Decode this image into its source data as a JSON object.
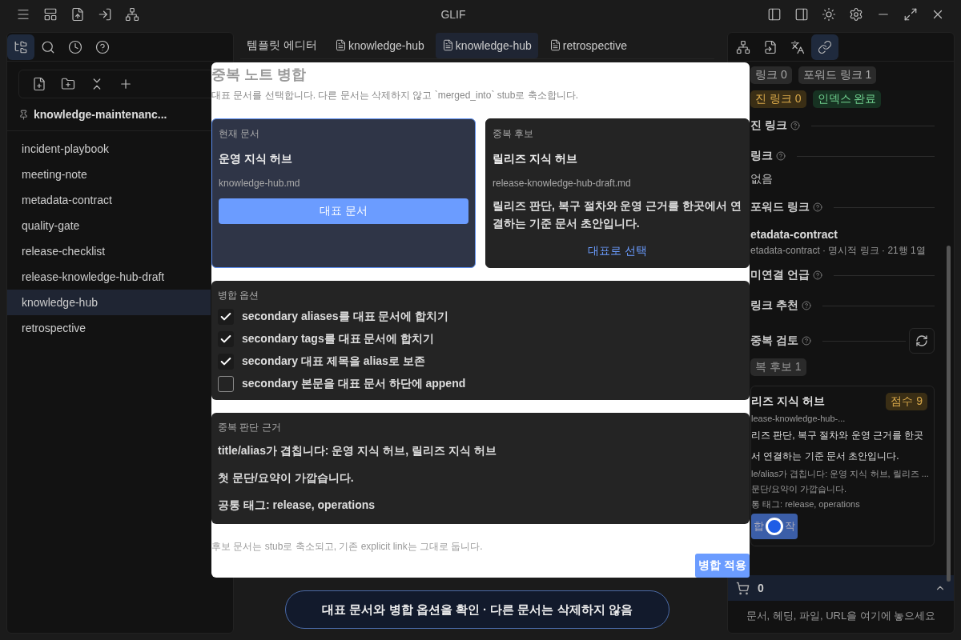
{
  "window": {
    "title": "GLIF"
  },
  "left_panel": {
    "pinned": "knowledge-maintenanc...",
    "items": [
      {
        "label": "incident-playbook",
        "selected": false
      },
      {
        "label": "meeting-note",
        "selected": false
      },
      {
        "label": "metadata-contract",
        "selected": false
      },
      {
        "label": "quality-gate",
        "selected": false
      },
      {
        "label": "release-checklist",
        "selected": false
      },
      {
        "label": "release-knowledge-hub-draft",
        "selected": false
      },
      {
        "label": "knowledge-hub",
        "selected": true
      },
      {
        "label": "retrospective",
        "selected": false
      }
    ]
  },
  "tabs": [
    {
      "label": "템플릿 에디터",
      "kind": "plain",
      "selected": false
    },
    {
      "label": "knowledge-hub",
      "kind": "file",
      "selected": false
    },
    {
      "label": "knowledge-hub",
      "kind": "file",
      "selected": true
    },
    {
      "label": "retrospective",
      "kind": "file",
      "selected": false
    }
  ],
  "dialog": {
    "title": "중복 노트 병합",
    "subtitle": "대표 문서를 선택합니다. 다른 문서는 삭제하지 않고 `merged_into` stub로 축소합니다.",
    "cards": [
      {
        "caption": "현재 문서",
        "title": "운영 지식 허브",
        "file": "knowledge-hub.md",
        "selected": true,
        "action": "대표 문서"
      },
      {
        "caption": "중복 후보",
        "title": "릴리즈 지식 허브",
        "file": "release-knowledge-hub-draft.md",
        "summary": "릴리즈 판단, 복구 절차와 운영 근거를 한곳에서 연결하는 기준 문서 초안입니다.",
        "selected": false,
        "action": "대표로 선택"
      }
    ],
    "options": {
      "heading": "병합 옵션",
      "items": [
        {
          "label": "secondary aliases를 대표 문서에 합치기",
          "checked": true
        },
        {
          "label": "secondary tags를 대표 문서에 합치기",
          "checked": true
        },
        {
          "label": "secondary 대표 제목을 alias로 보존",
          "checked": true
        },
        {
          "label": "secondary 본문을 대표 문서 하단에 append",
          "checked": false
        }
      ]
    },
    "evidence": {
      "heading": "중복 판단 근거",
      "lines": [
        "title/alias가 겹칩니다: 운영 지식 허브, 릴리즈 지식 허브",
        "첫 문단/요약이 가깝습니다.",
        "공통 태그: release, operations"
      ]
    },
    "note": "후보 문서는 stub로 축소되고, 기존 explicit link는 그대로 둡니다.",
    "apply_button": "병합 적용"
  },
  "status_pill": "대표 문서와 병합 옵션을 확인 · 다른 문서는 삭제하지 않음",
  "right_panel": {
    "tabs": [
      {
        "selected": false
      },
      {
        "selected": false
      },
      {
        "selected": false
      },
      {
        "selected": true
      }
    ],
    "badges": [
      {
        "label": "링크 0",
        "kind": "neutral"
      },
      {
        "label": "포워드 링크 1",
        "kind": "neutral"
      },
      {
        "label": "진 링크 0",
        "kind": "warning"
      },
      {
        "label": "인덱스 완료",
        "kind": "success"
      }
    ],
    "sections": [
      {
        "heading": "진 링크"
      },
      {
        "heading": "링크",
        "empty": "없음"
      },
      {
        "heading": "포워드 링크",
        "items": [
          {
            "title": "etadata-contract",
            "meta": "etadata-contract · 명시적 링크 · 21행 1열"
          }
        ]
      },
      {
        "heading": "미연결 언급"
      },
      {
        "heading": "링크 추천"
      }
    ],
    "duplicates": {
      "heading": "중복 검토",
      "count": "복 후보 1",
      "candidate": {
        "title": "리즈 지식 허브",
        "score": "점수 9",
        "file": "lease-knowledge-hub-...",
        "summary": [
          "리즈 판단, 복구 절차와 운영 근거를 한곳",
          "서 연결하는 기준 문서 초안입니다."
        ],
        "reasons": [
          "le/alias가 겹칩니다: 운영 지식 허브, 릴리즈 ...",
          "문단/요약이 가깝습니다.",
          "통 태그: release, operations"
        ],
        "button": [
          "합",
          "작"
        ]
      }
    },
    "cart": {
      "count": "0",
      "drop_hint": "문서, 헤딩, 파일, URL을 여기에 놓으세요"
    }
  }
}
